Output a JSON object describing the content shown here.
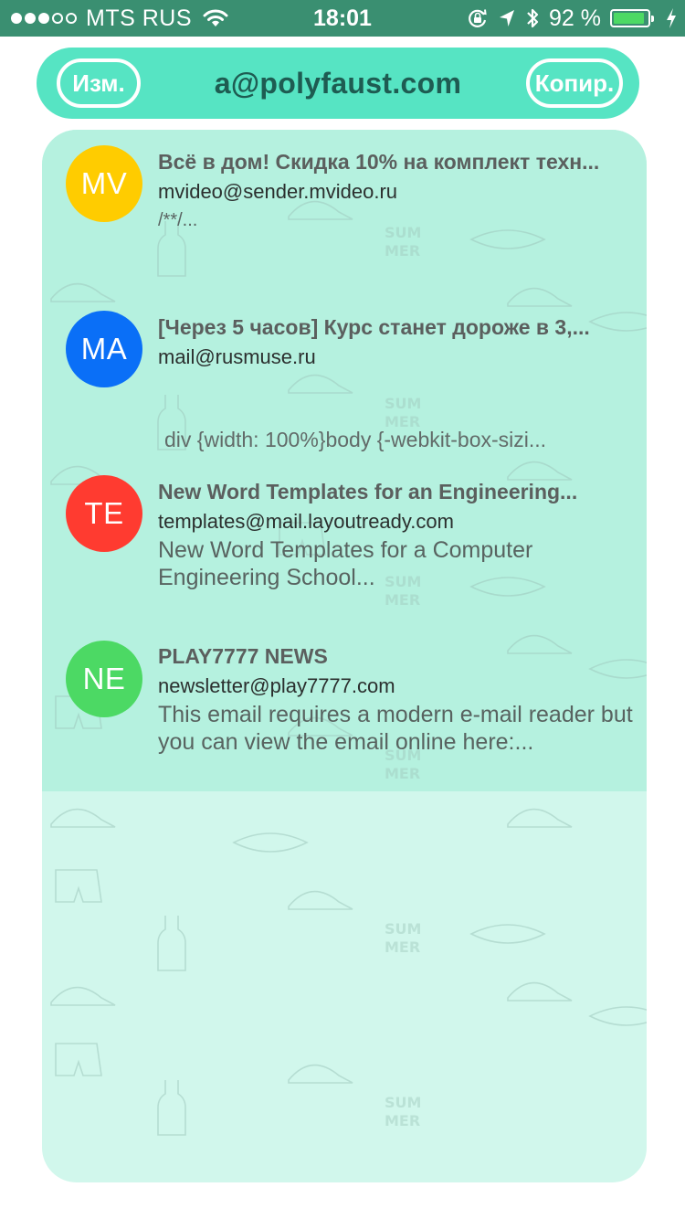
{
  "status_bar": {
    "carrier": "MTS RUS",
    "time": "18:01",
    "battery_percent_label": "92 %",
    "battery_level": 0.92,
    "signal_bars_filled": 3,
    "signal_bars_total": 5,
    "icons": [
      "wifi-icon",
      "orientation-lock-icon",
      "location-arrow-icon",
      "bluetooth-icon",
      "battery-icon",
      "charging-bolt-icon"
    ]
  },
  "header": {
    "edit_label": "Изм.",
    "email": "a@polyfaust.com",
    "copy_label": "Копир."
  },
  "colors": {
    "status_bar": "#3a8f71",
    "header": "#56e4c3",
    "list_filled": "#b5f1df",
    "list_empty": "#d1f7ec"
  },
  "mails": [
    {
      "initials": "MV",
      "avatar_color": "#ffcc00",
      "subject": "Всё в дом! Скидка 10% на комплект техн...",
      "sender": "mvideo@sender.mvideo.ru",
      "preview": "/**/..."
    },
    {
      "initials": "MA",
      "avatar_color": "#0a6ff7",
      "subject": "[Через 5 часов] Курс станет дороже в 3,...",
      "sender": "mail@rusmuse.ru",
      "preview": "div {width: 100%}body {-webkit-box-sizi..."
    },
    {
      "initials": "TE",
      "avatar_color": "#ff3b30",
      "subject": "New Word Templates for an Engineering...",
      "sender": "templates@mail.layoutready.com",
      "preview": "New Word Templates for a Computer Engineering School..."
    },
    {
      "initials": "NE",
      "avatar_color": "#4cd964",
      "subject": "PLAY7777 NEWS",
      "sender": "newsletter@play7777.com",
      "preview": "This email requires a modern e-mail reader but you can view the email online here:..."
    }
  ]
}
